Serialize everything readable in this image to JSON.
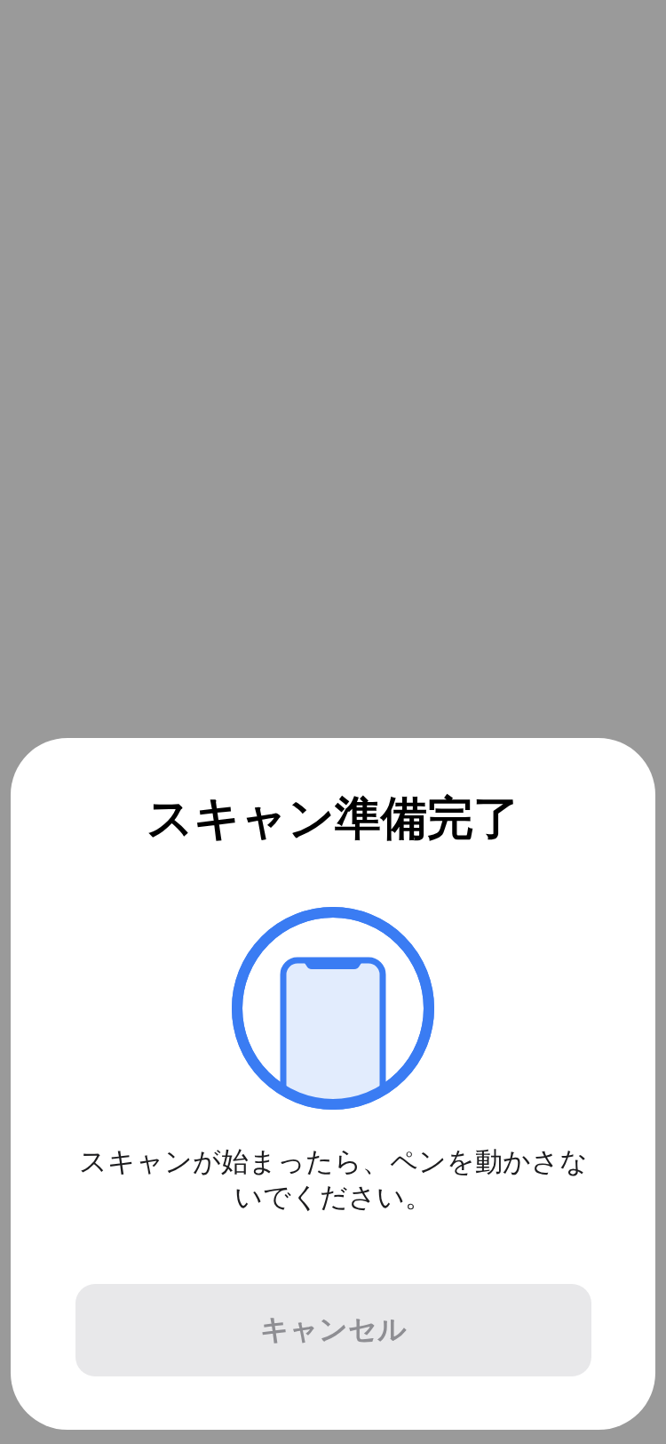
{
  "sheet": {
    "title": "スキャン準備完了",
    "message": "スキャンが始まったら、ペンを動かさないでください。",
    "cancel_button": {
      "label": "キャンセル",
      "disabled": true
    }
  }
}
